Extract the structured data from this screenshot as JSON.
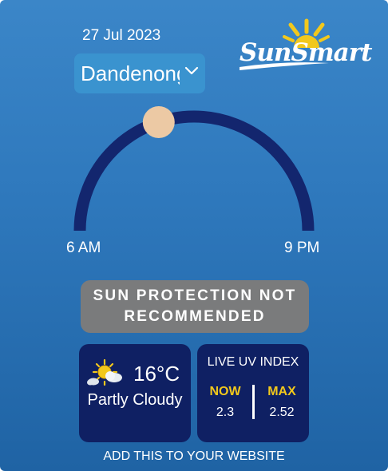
{
  "widget": {
    "date": "27 Jul 2023",
    "location": {
      "selected": "Dandenong",
      "icon": "chevron-down-icon"
    },
    "logo": {
      "text": "SunSmart",
      "icon": "sun-rays-icon"
    },
    "sun_track": {
      "start_time": "6 AM",
      "end_time": "9 PM",
      "sun_position_fraction": 0.4,
      "track_color": "#13266e",
      "sun_color": "#ecc9a4"
    },
    "protection": {
      "text": "SUN PROTECTION NOT RECOMMENDED",
      "color": "#7a7b7c"
    },
    "weather": {
      "temperature": "16°C",
      "condition": "Partly Cloudy",
      "icon": "partly-cloudy-icon"
    },
    "uv": {
      "title": "LIVE UV INDEX",
      "now_label": "NOW",
      "now_value": "2.3",
      "max_label": "MAX",
      "max_value": "2.52",
      "label_color": "#f2c81c"
    },
    "footer": "ADD THIS TO YOUR WEBSITE"
  }
}
